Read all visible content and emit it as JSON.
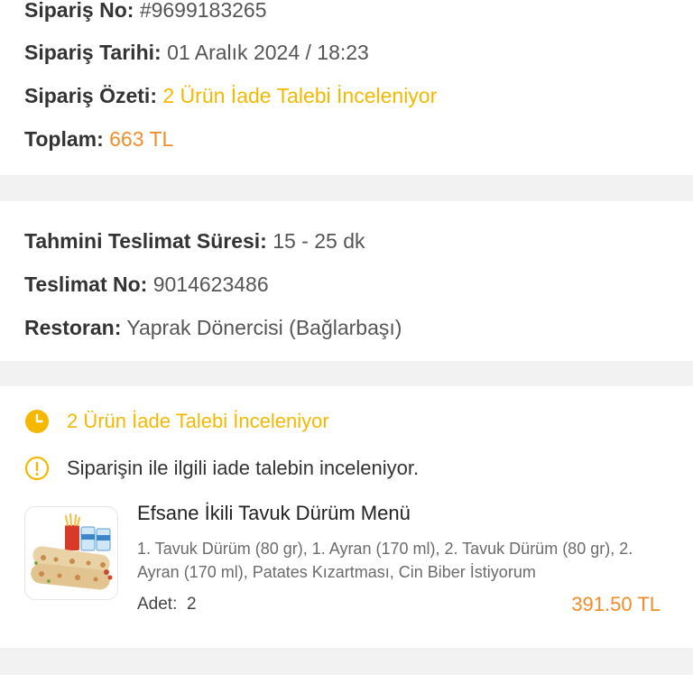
{
  "order": {
    "number_label": "Sipariş No:",
    "number_value": "#9699183265",
    "date_label": "Sipariş Tarihi:",
    "date_value": "01 Aralık 2024 / 18:23",
    "summary_label": "Sipariş Özeti:",
    "summary_value": "2 Ürün İade Talebi İnceleniyor",
    "total_label": "Toplam:",
    "total_value": "663 TL"
  },
  "delivery": {
    "eta_label": "Tahmini Teslimat Süresi:",
    "eta_value": "15 - 25 dk",
    "number_label": "Teslimat No:",
    "number_value": "9014623486",
    "restaurant_label": "Restoran:",
    "restaurant_value": "Yaprak Dönercisi (Bağlarbaşı)"
  },
  "refund": {
    "status_text": "2 Ürün İade Talebi İnceleniyor",
    "status_icon": "clock-icon",
    "info_text": "Siparişin ile ilgili iade talebin inceleniyor.",
    "info_icon": "info-icon",
    "product": {
      "name": "Efsane İkili Tavuk Dürüm Menü",
      "description": "1. Tavuk Dürüm (80 gr), 1. Ayran (170 ml), 2. Tavuk Dürüm (80 gr), 2. Ayran (170 ml), Patates Kızartması, Cin Biber İstiyorum",
      "qty_label": "Adet:",
      "qty_value": "2",
      "price": "391.50 TL"
    }
  },
  "colors": {
    "accent_amber": "#f5b800",
    "accent_orange": "#f28c28",
    "background": "#f2f2f2"
  }
}
